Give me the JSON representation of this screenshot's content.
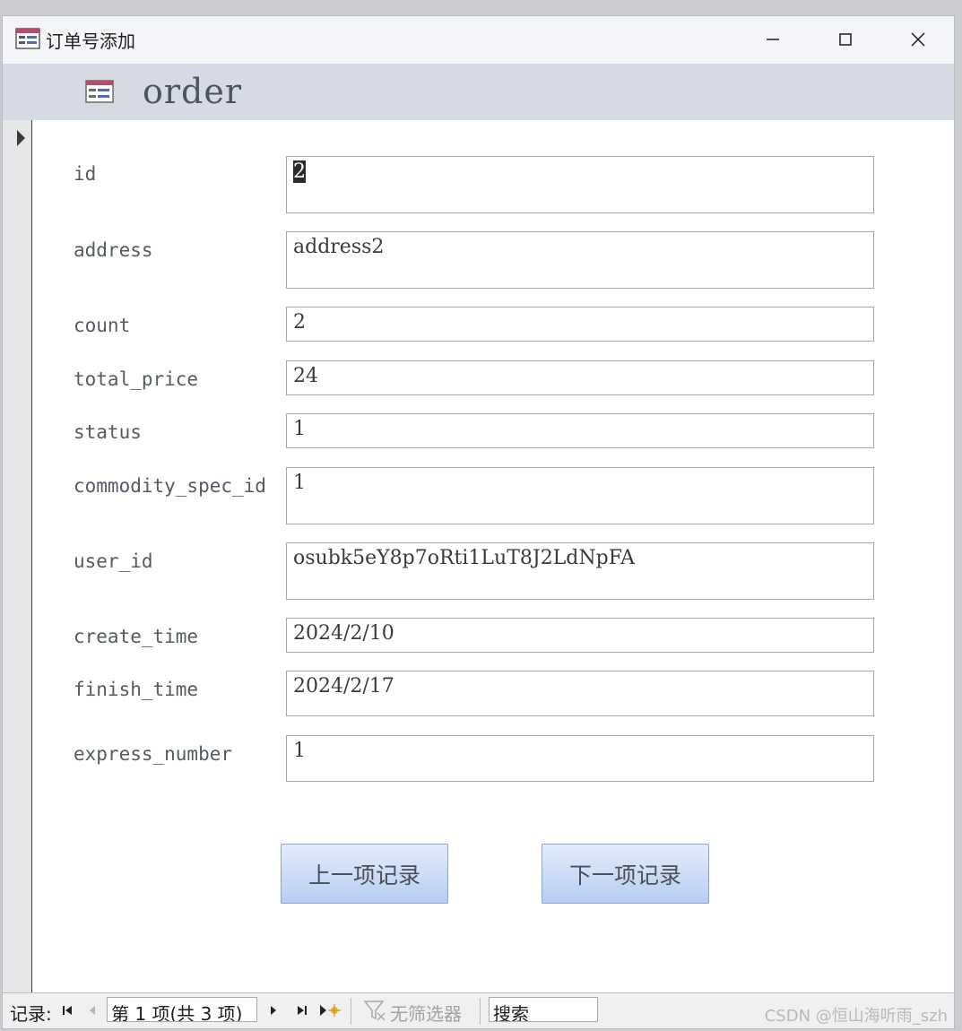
{
  "window": {
    "title": "订单号添加",
    "form_title": "order"
  },
  "fields": [
    {
      "name": "id-field",
      "label": "id",
      "value": "2"
    },
    {
      "name": "address-field",
      "label": "address",
      "value": "address2"
    },
    {
      "name": "count-field",
      "label": "count",
      "value": "2"
    },
    {
      "name": "total-price-field",
      "label": "total_price",
      "value": "24"
    },
    {
      "name": "status-field",
      "label": "status",
      "value": "1"
    },
    {
      "name": "commodity-spec-id-field",
      "label": "commodity_spec_id",
      "value": "1"
    },
    {
      "name": "user-id-field",
      "label": "user_id",
      "value": "osubk5eY8p7oRti1LuT8J2LdNpFA"
    },
    {
      "name": "create-time-field",
      "label": "create_time",
      "value": "2024/2/10"
    },
    {
      "name": "finish-time-field",
      "label": "finish_time",
      "value": "2024/2/17"
    },
    {
      "name": "express-number-field",
      "label": "express_number",
      "value": "1"
    }
  ],
  "buttons": {
    "prev_label": "上一项记录",
    "next_label": "下一项记录"
  },
  "statusbar": {
    "record_label": "记录:",
    "position": "第 1 项(共 3 项)",
    "filter_label": "无筛选器",
    "search_label": "搜索"
  },
  "watermark": "CSDN @恒山海听雨_szh",
  "colors": {
    "header_band": "#d6dae2",
    "button_gradient_top": "#e3ecfb",
    "button_gradient_bottom": "#b7cdf2",
    "label_text": "#545a66"
  }
}
